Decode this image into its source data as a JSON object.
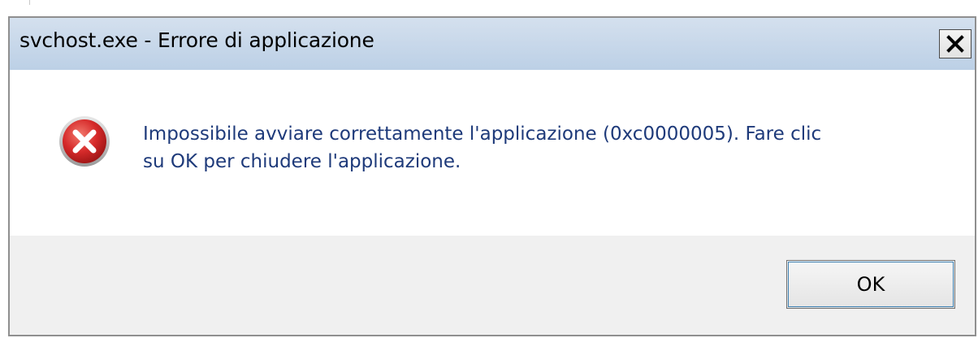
{
  "window": {
    "title": "svchost.exe - Errore di applicazione",
    "close_glyph": "X"
  },
  "message": {
    "icon": "error-icon",
    "line1": "Impossibile avviare correttamente l'applicazione (0xc0000005). Fare clic",
    "line2": "su OK per chiudere l'applicazione."
  },
  "buttons": {
    "ok_label": "OK"
  },
  "colors": {
    "titlebar": "#bcd0e6",
    "message_text": "#1e3a7a",
    "error_red": "#d62a2a",
    "footer": "#f0f0f0"
  }
}
